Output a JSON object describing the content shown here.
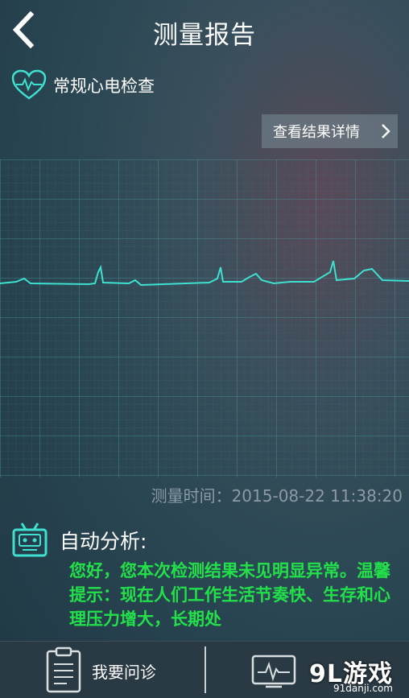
{
  "header": {
    "title": "测量报告"
  },
  "exam": {
    "label": "常规心电检查"
  },
  "detail_button": {
    "label": "查看结果详情"
  },
  "measurement": {
    "time_label": "测量时间：",
    "time_value": "2015-08-22 11:38:20"
  },
  "analysis": {
    "title": "自动分析:",
    "text": "您好，您本次检测结果未见明显异常。温馨提示：现在人们工作生活节奏快、生存和心理压力增大，长期处"
  },
  "bottom_bar": {
    "consult_label": "我要问诊"
  },
  "watermark": {
    "logo": "9L游戏",
    "url": "91danji.com"
  },
  "colors": {
    "accent": "#3ee0d0",
    "analysis_text": "#22e04a",
    "time_text": "#8b9aa3"
  }
}
